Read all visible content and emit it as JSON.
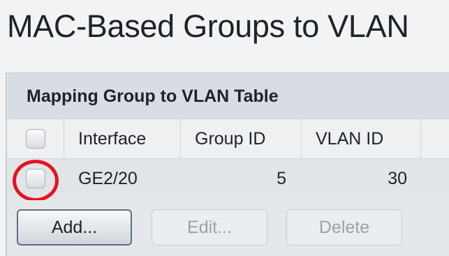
{
  "page": {
    "title": "MAC-Based Groups to VLAN"
  },
  "table": {
    "title": "Mapping Group to VLAN Table",
    "columns": [
      "Interface",
      "Group ID",
      "VLAN ID"
    ],
    "rows": [
      {
        "interface": "GE2/20",
        "group_id": "5",
        "vlan_id": "30",
        "selected": false
      }
    ]
  },
  "toolbar": {
    "add_label": "Add...",
    "edit_label": "Edit...",
    "delete_label": "Delete"
  },
  "colors": {
    "highlight_ring": "#e4131f",
    "add_border": "#5d6f84",
    "disabled_text": "#9aa1a7"
  }
}
